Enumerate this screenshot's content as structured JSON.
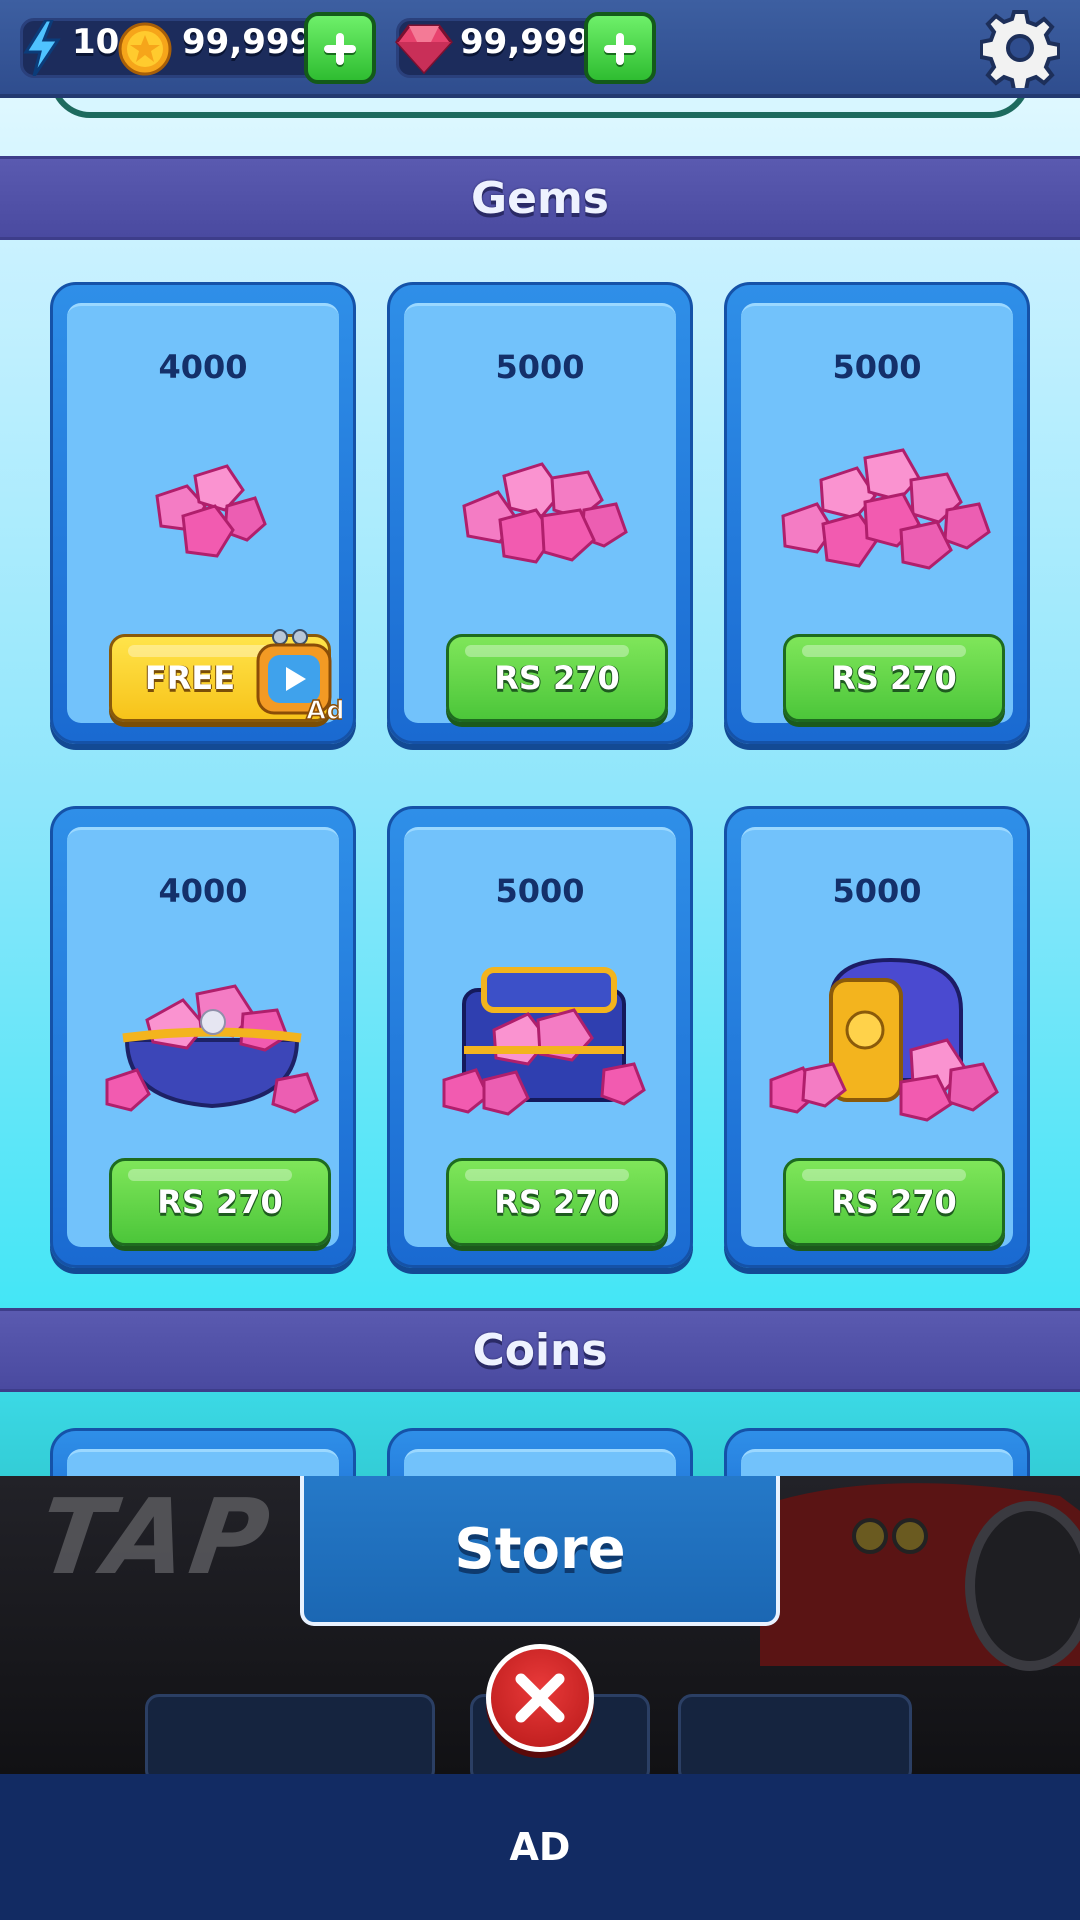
{
  "topbar": {
    "energy": "10",
    "coins": "99,999",
    "gems": "99,999",
    "icons": [
      "bolt-icon",
      "coin-icon",
      "gem-icon",
      "plus-icon",
      "gear-icon"
    ]
  },
  "sections": {
    "gems_title": "Gems",
    "coins_title": "Coins"
  },
  "gem_offers": [
    {
      "amount": "4000",
      "price": "FREE",
      "art": "small-gem-pile",
      "button_type": "watch-ad"
    },
    {
      "amount": "5000",
      "price": "RS 270",
      "art": "medium-gem-pile",
      "button_type": "purchase"
    },
    {
      "amount": "5000",
      "price": "RS 270",
      "art": "large-gem-pile",
      "button_type": "purchase"
    },
    {
      "amount": "4000",
      "price": "RS 270",
      "art": "gem-purse",
      "button_type": "purchase"
    },
    {
      "amount": "5000",
      "price": "RS 270",
      "art": "gem-chest",
      "button_type": "purchase"
    },
    {
      "amount": "5000",
      "price": "RS 270",
      "art": "gem-vault",
      "button_type": "purchase"
    }
  ],
  "ad_badge": "Ad",
  "background_text": "TAP T",
  "store": {
    "title": "Store"
  },
  "ad_banner": {
    "label": "AD"
  },
  "colors": {
    "gem_pink": "#f25bb0",
    "buy_green": "#4cc63a",
    "free_yellow": "#f7c31a",
    "header_purple": "#4a4aa0",
    "close_red": "#d22626"
  }
}
